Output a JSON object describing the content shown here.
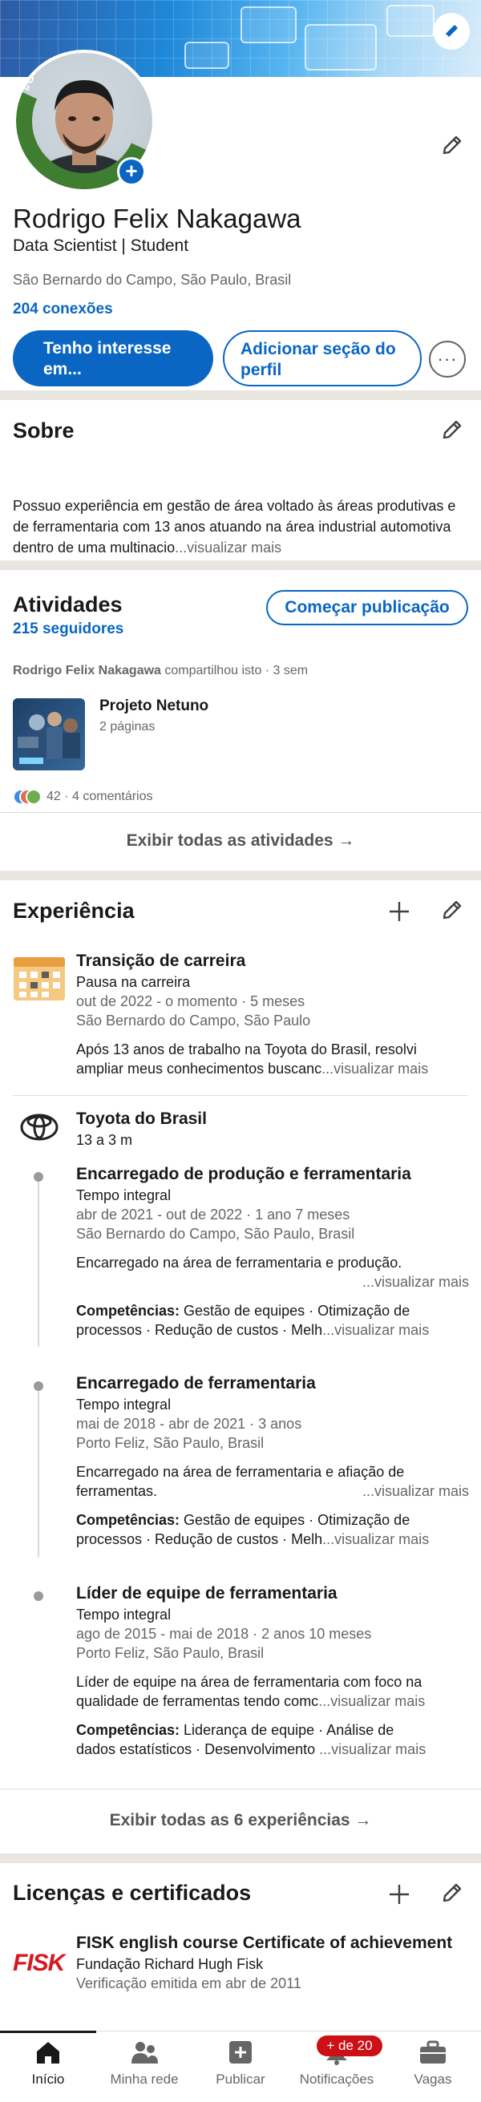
{
  "profile": {
    "name": "Rodrigo Felix Nakagawa",
    "headline": "Data Scientist | Student",
    "location": "São Bernardo do Campo, São Paulo, Brasil",
    "connections": "204 conexões",
    "open_to_work_frame": "#OPENTOWORK",
    "primary_button": "Tenho interesse em...",
    "secondary_button": "Adicionar seção do perfil",
    "more_button": "···"
  },
  "about": {
    "title": "Sobre",
    "text": "Possuo experiência em gestão de área voltado às áreas produtivas e de ferramentaria com 13 anos atuando na área industrial automotiva dentro de uma multinacio",
    "more": "...visualizar mais"
  },
  "activity": {
    "title": "Atividades",
    "followers": "215 seguidores",
    "start_post": "Começar publicação",
    "author": "Rodrigo Felix Nakagawa",
    "shared": "compartilhou isto · 3 sem",
    "post_title": "Projeto Netuno",
    "post_pages": "2 páginas",
    "reactions": "42 · 4 comentários",
    "show_all": "Exibir todas as atividades →"
  },
  "experience": {
    "title": "Experiência",
    "items": [
      {
        "title": "Transição de carreira",
        "subtitle": "Pausa na carreira",
        "dates": "out de 2022 - o momento · 5 meses",
        "location": "São Bernardo do Campo, São Paulo",
        "desc1": "Após 13 anos de trabalho na Toyota do Brasil, resolvi",
        "desc2": "ampliar meus conhecimentos buscanc",
        "more": "...visualizar mais"
      }
    ],
    "company": {
      "name": "Toyota do Brasil",
      "duration": "13 a 3 m",
      "roles": [
        {
          "title": "Encarregado de produção e ferramentaria",
          "type": "Tempo integral",
          "dates": "abr de 2021 - out de 2022 · 1 ano 7 meses",
          "location": "São Bernardo do Campo, São Paulo, Brasil",
          "desc1": "Encarregado na área de ferramentaria e produção.",
          "desc2": "",
          "desc_more": "...visualizar mais",
          "skills_label": "Competências:",
          "skills1": " Gestão de equipes · Otimização de",
          "skills2": "processos · Redução de custos · Melh",
          "skills_more": "...visualizar mais"
        },
        {
          "title": "Encarregado de ferramentaria",
          "type": "Tempo integral",
          "dates": "mai de 2018 - abr de 2021 · 3 anos",
          "location": "Porto Feliz, São Paulo, Brasil",
          "desc1": "Encarregado na área de ferramentaria e afiação de",
          "desc2": "ferramentas.",
          "desc_more": "...visualizar mais",
          "skills_label": "Competências:",
          "skills1": " Gestão de equipes · Otimização de",
          "skills2": "processos · Redução de custos · Melh",
          "skills_more": "...visualizar mais"
        },
        {
          "title": "Líder de equipe de ferramentaria",
          "type": "Tempo integral",
          "dates": "ago de 2015 - mai de 2018 · 2 anos 10 meses",
          "location": "Porto Feliz, São Paulo, Brasil",
          "desc1": "Líder de equipe na área de ferramentaria com foco na",
          "desc2": "qualidade de ferramentas tendo comc",
          "desc_more": "...visualizar mais",
          "skills_label": "Competências:",
          "skills1": " Liderança de equipe · Análise de",
          "skills2": "dados estatísticos · Desenvolvimento ",
          "skills_more": "...visualizar mais"
        }
      ]
    },
    "show_all": "Exibir todas as 6 experiências →"
  },
  "licenses": {
    "title": "Licenças e certificados",
    "logo_text": "FISK",
    "cert_title": "FISK english course Certificate of achievement",
    "issuer": "Fundação Richard Hugh Fisk",
    "issued": "Verificação emitida em abr de 2011"
  },
  "bottom_nav": {
    "items": [
      {
        "label": "Início",
        "icon": "home-icon"
      },
      {
        "label": "Minha rede",
        "icon": "network-icon"
      },
      {
        "label": "Publicar",
        "icon": "post-icon"
      },
      {
        "label": "Notificações",
        "icon": "bell-icon"
      },
      {
        "label": "Vagas",
        "icon": "briefcase-icon"
      }
    ],
    "notif_badge": "+ de 20"
  },
  "colors": {
    "accent": "#0a66c2",
    "open_to_work": "#3f7d30",
    "badge": "#cc1016"
  }
}
